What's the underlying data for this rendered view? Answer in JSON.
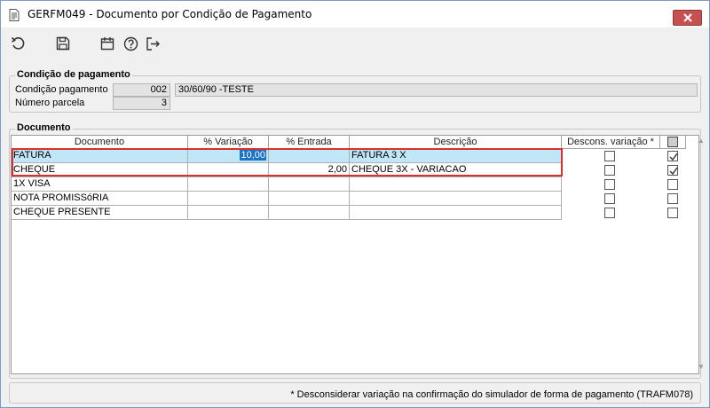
{
  "window": {
    "title": "GERFM049 - Documento por Condição de Pagamento"
  },
  "toolbar": {
    "icons": [
      "undo-icon",
      "save-icon",
      "calendar-icon",
      "help-icon",
      "exit-icon"
    ]
  },
  "condicao": {
    "legend": "Condição de pagamento",
    "condicao_label": "Condição pagamento",
    "condicao_code": "002",
    "condicao_desc": "30/60/90 -TESTE",
    "parcela_label": "Número parcela",
    "parcela_value": "3"
  },
  "documento": {
    "legend": "Documento",
    "columns": [
      "Documento",
      "% Variação",
      "% Entrada",
      "Descrição",
      "Descons. variação *"
    ],
    "rows": [
      {
        "documento": "FATURA",
        "variacao": "10,00",
        "entrada": "",
        "descricao": "FATURA 3 X",
        "descons": false,
        "check": true
      },
      {
        "documento": "CHEQUE",
        "variacao": "",
        "entrada": "2,00",
        "descricao": "CHEQUE 3X - VARIACAO",
        "descons": false,
        "check": true
      },
      {
        "documento": "1X VISA",
        "variacao": "",
        "entrada": "",
        "descricao": "",
        "descons": false,
        "check": false
      },
      {
        "documento": "NOTA PROMISSóRIA",
        "variacao": "",
        "entrada": "",
        "descricao": "",
        "descons": false,
        "check": false
      },
      {
        "documento": "CHEQUE PRESENTE",
        "variacao": "",
        "entrada": "",
        "descricao": "",
        "descons": false,
        "check": false
      }
    ]
  },
  "footer": {
    "note": "* Desconsiderar variação na confirmação do simulador de forma de pagamento (TRAFM078)"
  },
  "colors": {
    "selected_row": "#bfe7f7",
    "selected_cell": "#1a73c7",
    "highlight_border": "#d9302c",
    "close_button": "#c75050"
  }
}
